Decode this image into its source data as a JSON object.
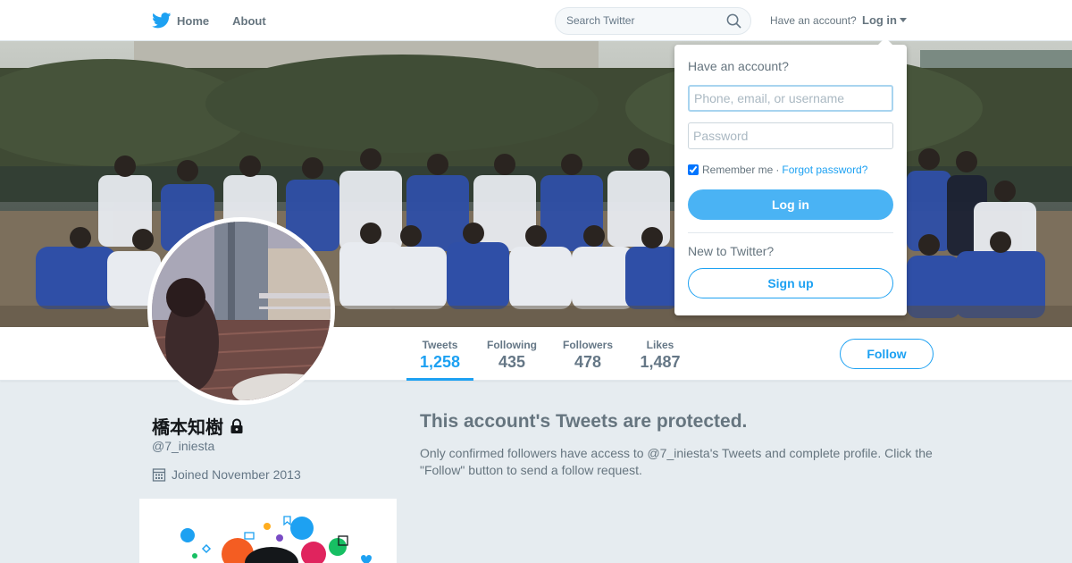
{
  "nav": {
    "home_label": "Home",
    "about_label": "About",
    "search_placeholder": "Search Twitter",
    "have_account": "Have an account?",
    "login_label": "Log in"
  },
  "profile": {
    "name": "橋本知樹",
    "screen_name": "@7_iniesta",
    "joined": "Joined November 2013",
    "protected_badge_icon": "lock-icon"
  },
  "stats": [
    {
      "label": "Tweets",
      "value": "1,258",
      "active": true
    },
    {
      "label": "Following",
      "value": "435",
      "active": false
    },
    {
      "label": "Followers",
      "value": "478",
      "active": false
    },
    {
      "label": "Likes",
      "value": "1,487",
      "active": false
    }
  ],
  "follow_label": "Follow",
  "protected": {
    "title": "This account's Tweets are protected.",
    "body": "Only confirmed followers have access to @7_iniesta's Tweets and complete profile. Click the \"Follow\" button to send a follow request."
  },
  "login_dropdown": {
    "heading": "Have an account?",
    "username_placeholder": "Phone, email, or username",
    "password_placeholder": "Password",
    "remember_label": "Remember me",
    "separator": "·",
    "forgot_label": "Forgot password?",
    "login_button": "Log in",
    "new_heading": "New to Twitter?",
    "signup_button": "Sign up",
    "remember_checked": true
  },
  "colors": {
    "brand_blue": "#1da1f2",
    "button_blue": "#4ab3f4",
    "page_bg": "#e6ecf0",
    "muted_text": "#657786"
  }
}
